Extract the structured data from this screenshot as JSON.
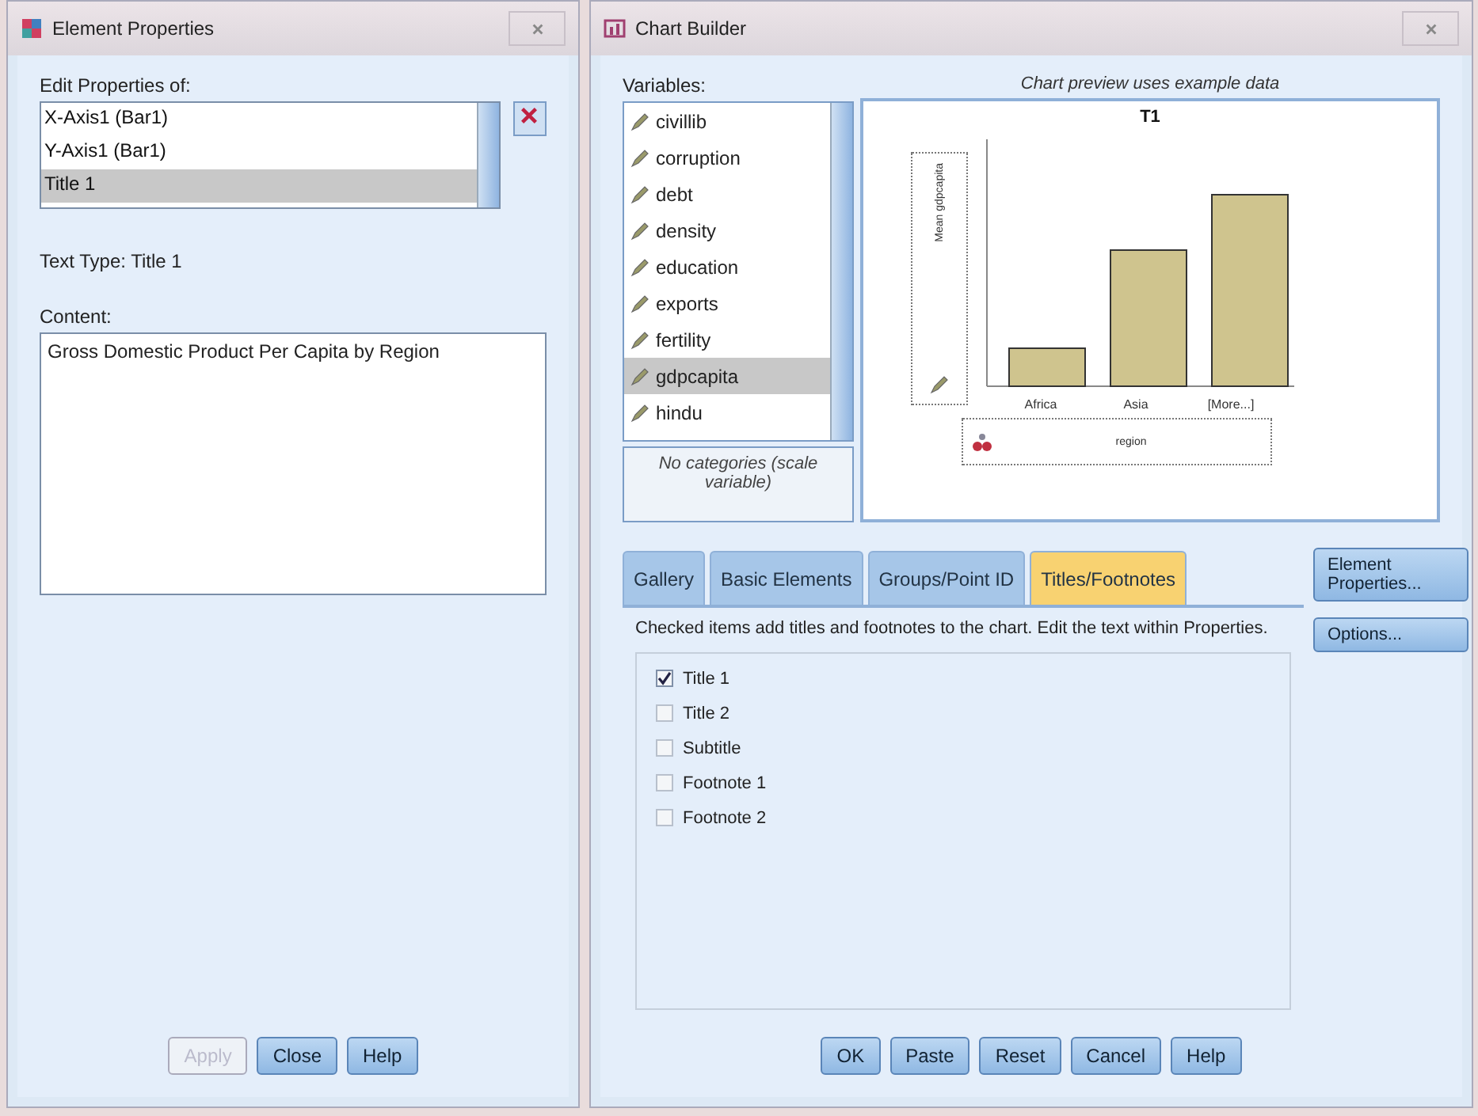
{
  "element_properties": {
    "title": "Element Properties",
    "edit_label": "Edit Properties of:",
    "elements": [
      {
        "label": "X-Axis1 (Bar1)",
        "selected": false
      },
      {
        "label": "Y-Axis1 (Bar1)",
        "selected": false
      },
      {
        "label": "Title 1",
        "selected": true
      }
    ],
    "text_type": "Text Type: Title 1",
    "content_label": "Content:",
    "content": "Gross Domestic Product Per Capita by Region",
    "buttons": [
      {
        "label": "Apply",
        "disabled": true
      },
      {
        "label": "Close",
        "disabled": false
      },
      {
        "label": "Help",
        "disabled": false
      }
    ]
  },
  "chart_builder": {
    "title": "Chart Builder",
    "variables_label": "Variables:",
    "variables": [
      {
        "name": "civillib",
        "selected": false
      },
      {
        "name": "corruption",
        "selected": false
      },
      {
        "name": "debt",
        "selected": false
      },
      {
        "name": "density",
        "selected": false
      },
      {
        "name": "education",
        "selected": false
      },
      {
        "name": "exports",
        "selected": false
      },
      {
        "name": "fertility",
        "selected": false
      },
      {
        "name": "gdpcapita",
        "selected": true
      },
      {
        "name": "hindu",
        "selected": false
      }
    ],
    "categories_note": "No categories (scale variable)",
    "preview_note": "Chart preview uses example data",
    "preview": {
      "title": "T1",
      "y_zone": [
        "Mean",
        "gdpcapita"
      ],
      "x_labels": [
        "Africa",
        "Asia",
        "[More...]"
      ],
      "x_zone": "region"
    },
    "tabs": [
      {
        "label": "Gallery",
        "selected": false
      },
      {
        "label": "Basic Elements",
        "selected": false
      },
      {
        "label": "Groups/Point ID",
        "selected": false
      },
      {
        "label": "Titles/Footnotes",
        "selected": true
      }
    ],
    "instructions": "Checked items add titles and footnotes to the chart. Edit the text within Properties.",
    "items": [
      {
        "label": "Title 1",
        "checked": true
      },
      {
        "label": "Title 2",
        "checked": false
      },
      {
        "label": "Subtitle",
        "checked": false
      },
      {
        "label": "Footnote 1",
        "checked": false
      },
      {
        "label": "Footnote 2",
        "checked": false
      }
    ],
    "side_buttons": [
      "Element Properties...",
      "Options..."
    ],
    "buttons": [
      "OK",
      "Paste",
      "Reset",
      "Cancel",
      "Help"
    ]
  }
}
